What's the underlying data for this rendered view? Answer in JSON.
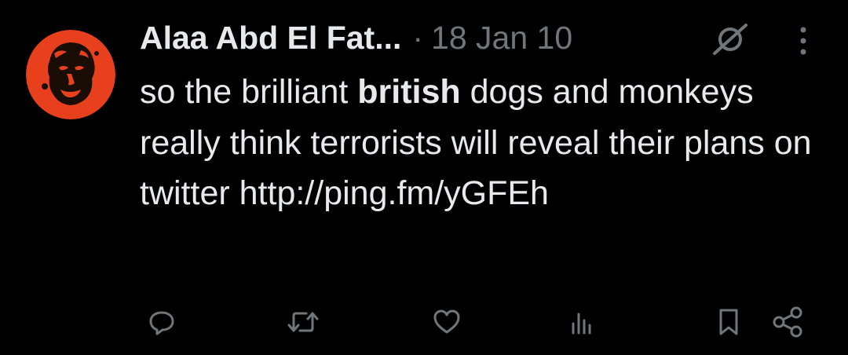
{
  "tweet": {
    "author_name": "Alaa Abd El Fat...",
    "separator": "·",
    "date": "18 Jan 10",
    "text_prefix": "so the brilliant ",
    "text_bold": "british",
    "text_suffix": " dogs and monkeys really think terrorists will reveal their plans on twitter ",
    "link": "http://ping.fm/yGFEh"
  },
  "colors": {
    "background": "#000000",
    "text": "#e7e9ea",
    "secondary": "#71767b",
    "avatar_bg": "#e8401c",
    "avatar_fg": "#1a0d05"
  },
  "icons": {
    "hidden": "eye-slash-icon",
    "more": "more-vertical-icon",
    "reply": "reply-icon",
    "retweet": "retweet-icon",
    "like": "heart-icon",
    "views": "views-icon",
    "bookmark": "bookmark-icon",
    "share": "share-icon"
  }
}
